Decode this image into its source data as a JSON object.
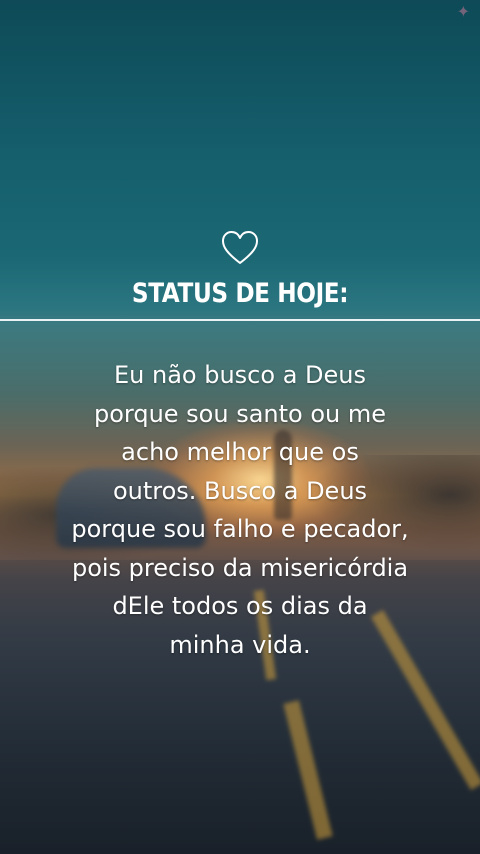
{
  "title": "STATUS DE HOJE:",
  "quote_lines": [
    "Eu não busco a Deus",
    "porque sou santo ou me",
    "acho melhor que os",
    "outros. Busco a Deus",
    "porque sou falho e pecador,",
    "pois preciso da misericórdia",
    "dEle todos os dias da",
    "minha vida."
  ],
  "icons": {
    "heart": "heart-outline-icon",
    "corner": "sparkle-icon"
  },
  "colors": {
    "text": "#ffffff",
    "sky_top": "#0e4a57",
    "sunset": "#f5aa5a"
  }
}
